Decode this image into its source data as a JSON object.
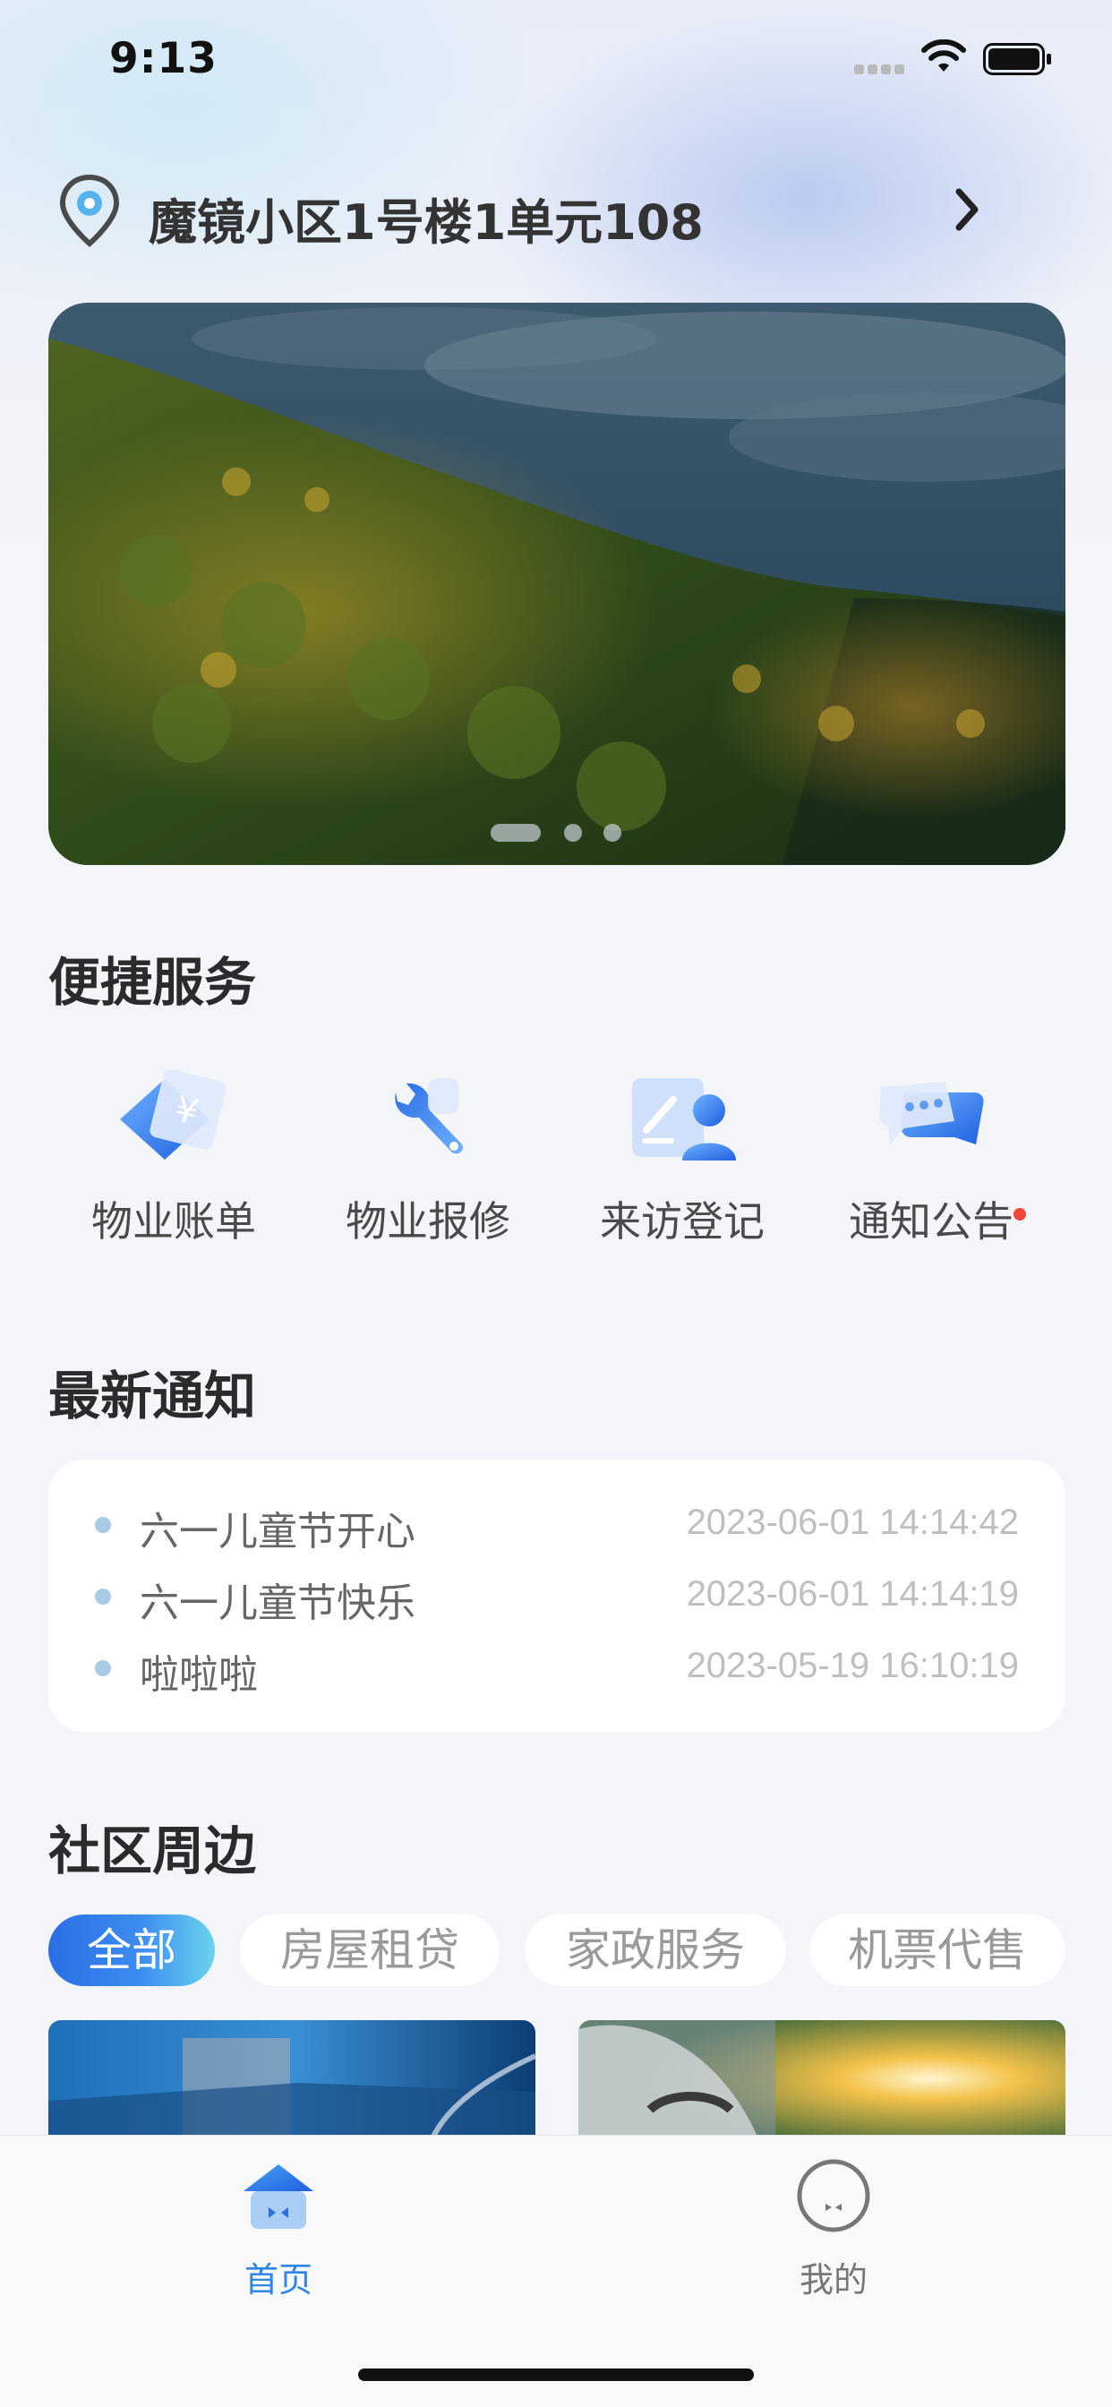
{
  "status_bar": {
    "time": "9:13"
  },
  "header": {
    "address": "魔镜小区1号楼1单元108"
  },
  "banner": {
    "page_count": 3,
    "active_page": 1
  },
  "quick_services": {
    "title": "便捷服务",
    "items": [
      {
        "label": "物业账单",
        "icon": "bill-icon",
        "badge": false
      },
      {
        "label": "物业报修",
        "icon": "wrench-icon",
        "badge": false
      },
      {
        "label": "来访登记",
        "icon": "visitor-register-icon",
        "badge": false
      },
      {
        "label": "通知公告",
        "icon": "chat-bubble-icon",
        "badge": true
      }
    ]
  },
  "notices": {
    "title": "最新通知",
    "items": [
      {
        "title": "六一儿童节开心",
        "time": "2023-06-01 14:14:42"
      },
      {
        "title": "六一儿童节快乐",
        "time": "2023-06-01 14:14:19"
      },
      {
        "title": "啦啦啦",
        "time": "2023-05-19 16:10:19"
      }
    ]
  },
  "nearby": {
    "title": "社区周边",
    "tabs": [
      {
        "label": "全部",
        "active": true
      },
      {
        "label": "房屋租贷",
        "active": false
      },
      {
        "label": "家政服务",
        "active": false
      },
      {
        "label": "机票代售",
        "active": false
      }
    ]
  },
  "tab_bar": {
    "items": [
      {
        "label": "首页",
        "icon": "home-icon",
        "active": true
      },
      {
        "label": "我的",
        "icon": "profile-icon",
        "active": false
      }
    ]
  },
  "colors": {
    "accent": "#2f86e6",
    "inactive_tab": "#777777",
    "badge": "#f2483c"
  }
}
